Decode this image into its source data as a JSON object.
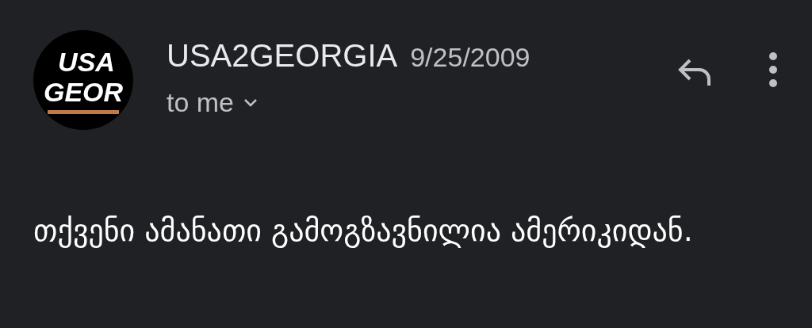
{
  "avatar": {
    "lines": [
      "USA",
      "GEOR"
    ]
  },
  "sender": {
    "name": "USA2GEORGIA",
    "date": "9/25/2009",
    "recipient": "to me"
  },
  "body": "თქვენი ამანათი გამოგზავნილია ამერიკიდან."
}
